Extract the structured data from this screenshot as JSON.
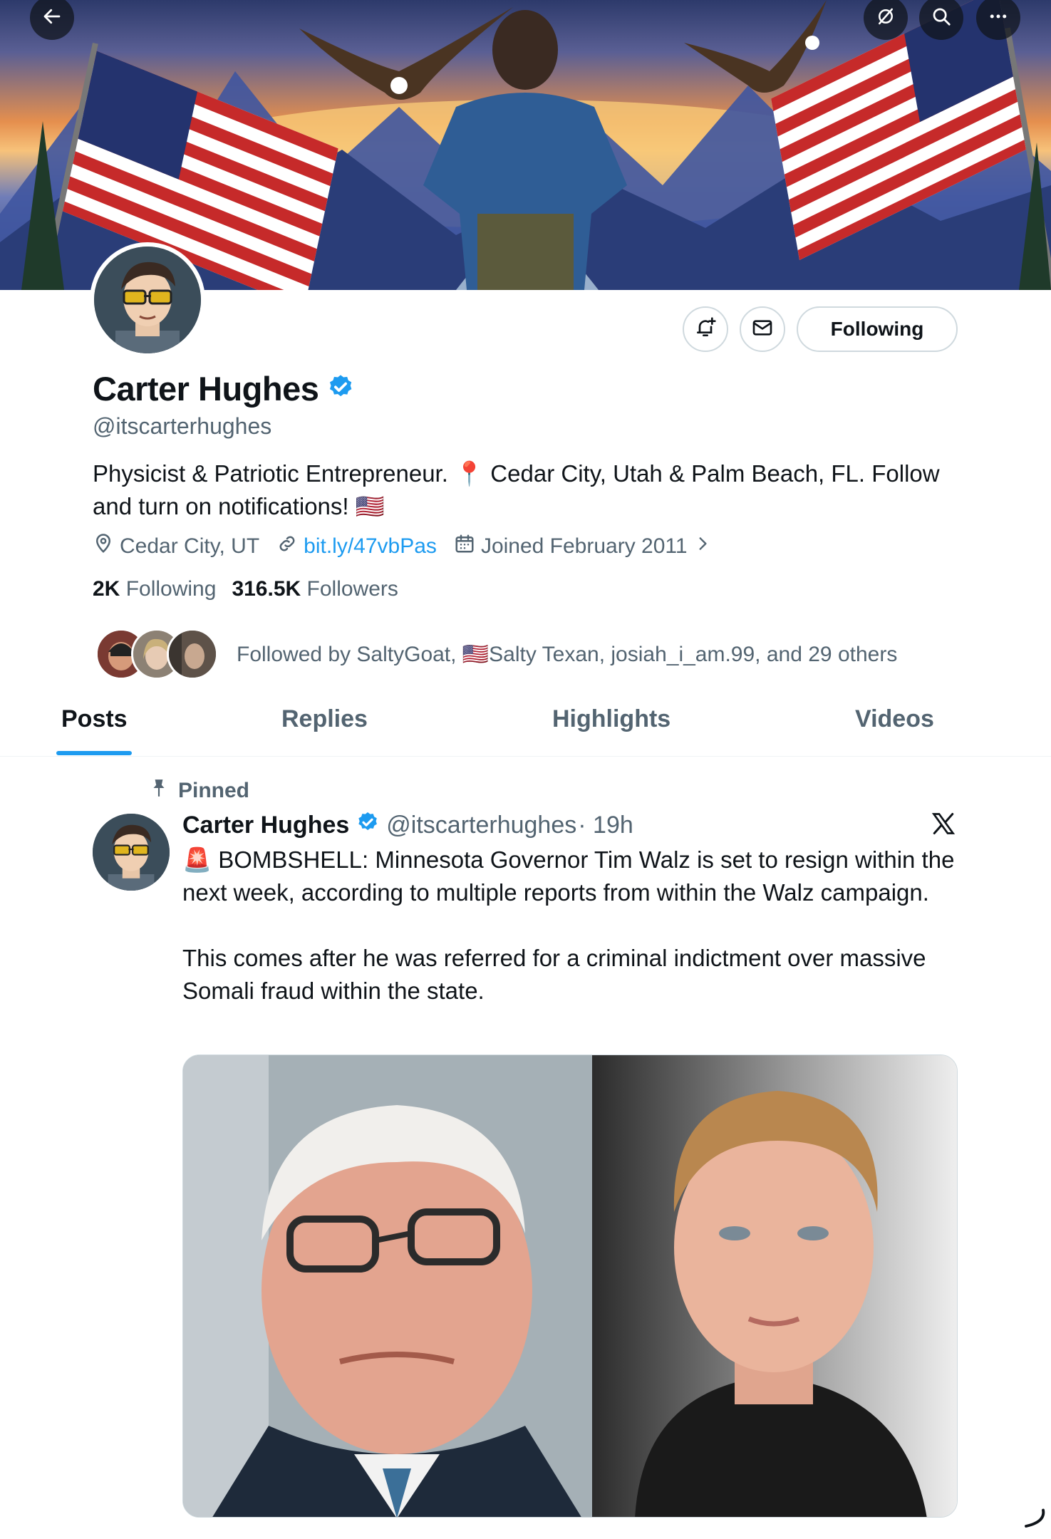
{
  "top_bar": {
    "back_icon": "arrow-left-icon",
    "grok_icon": "slash-circle-icon",
    "search_icon": "search-icon",
    "more_icon": "more-horizontal-icon"
  },
  "profile": {
    "name": "Carter Hughes",
    "verified": true,
    "handle": "@itscarterhughes",
    "bio": "Physicist & Patriotic Entrepreneur. 📍 Cedar City, Utah & Palm Beach, FL. Follow and turn on notifications! 🇺🇸",
    "location": "Cedar City, UT",
    "link": "bit.ly/47vbPas",
    "joined": "Joined February 2011",
    "following_count": "2K",
    "following_label": "Following",
    "followers_count": "316.5K",
    "followers_label": "Followers",
    "followed_by": "Followed by SaltyGoat, 🇺🇸Salty Texan, josiah_i_am.99, and 29 others"
  },
  "actions": {
    "notify_icon": "bell-plus-icon",
    "message_icon": "mail-icon",
    "following_button": "Following"
  },
  "tabs": [
    {
      "label": "Posts",
      "active": true
    },
    {
      "label": "Replies",
      "active": false
    },
    {
      "label": "Highlights",
      "active": false
    },
    {
      "label": "Videos",
      "active": false
    }
  ],
  "post": {
    "pinned_label": "Pinned",
    "author": "Carter Hughes",
    "handle": "@itscarterhughes",
    "time": "· 19h",
    "paragraph1": "🚨 BOMBSHELL: Minnesota Governor Tim Walz is set to resign within the next week, according to multiple reports from within the Walz campaign.",
    "paragraph2": "This comes after he was referred for a criminal indictment over massive Somali fraud within the state.",
    "source_icon": "x-logo-icon"
  },
  "colors": {
    "accent": "#1d9bf0",
    "text": "#0f1419",
    "secondary": "#536471",
    "border": "#cfd9de"
  }
}
